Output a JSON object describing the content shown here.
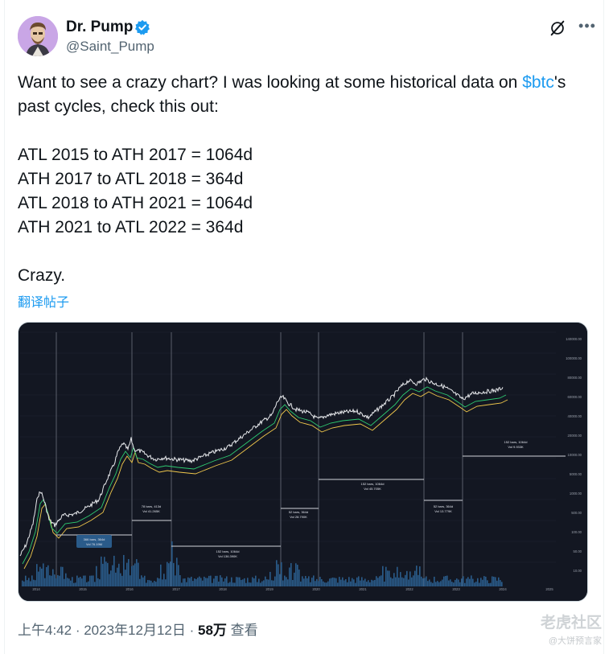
{
  "author": {
    "name": "Dr. Pump",
    "handle": "@Saint_Pump"
  },
  "tweet": {
    "intro_before": "Want to see a crazy chart? I was looking at some historical data on ",
    "cashtag": "$btc",
    "intro_after": "'s past cycles, check this out:",
    "lines": [
      "ATL 2015 to ATH 2017 = 1064d",
      "ATH 2017 to ATL 2018 = 364d",
      "ATL 2018 to ATH 2021 = 1064d",
      "ATH 2021 to ATL 2022 = 364d"
    ],
    "closing": "Crazy.",
    "translate_label": "翻译帖子"
  },
  "footer": {
    "time": "上午4:42",
    "date": "2023年12月12日",
    "views": "58万",
    "views_label": "查看"
  },
  "watermark": {
    "main": "老虎社区",
    "sub": "@大饼预言家"
  },
  "icons": {
    "verified": "verified-badge-icon",
    "grok": "grok-icon",
    "more": "more-icon"
  },
  "colors": {
    "accent": "#1d9bf0",
    "chart_bg": "#131722"
  },
  "chart_data": {
    "type": "line",
    "title": "",
    "annotations": [
      {
        "text": "366 bars, 364d",
        "sub": "Vol 76.19M"
      },
      {
        "text": "78 bars, 413d",
        "sub": "Vol 41.265K"
      },
      {
        "text": "152 bars, 1064d",
        "sub": "Vol 136.390K"
      },
      {
        "text": "52 bars, 364d",
        "sub": "Vol 28.790K"
      },
      {
        "text": "152 bars, 1064d",
        "sub": "Vol 45.705K"
      },
      {
        "text": "52 bars, 364d",
        "sub": "Vol 13.779K"
      },
      {
        "text": "152 bars, 1064d",
        "sub": "Vol 9.933K"
      }
    ],
    "x_ticks": [
      "2014",
      "2015",
      "2016",
      "2017",
      "2018",
      "2019",
      "2020",
      "2021",
      "2022",
      "2023",
      "2024",
      "2025"
    ],
    "y_ticks": [
      "140000.00",
      "100000.00",
      "80000.00",
      "60000.00",
      "40000.00",
      "20000.00",
      "10000.00",
      "5000.00",
      "1000.00",
      "500.00",
      "100.00",
      "50.00",
      "10.00"
    ]
  }
}
